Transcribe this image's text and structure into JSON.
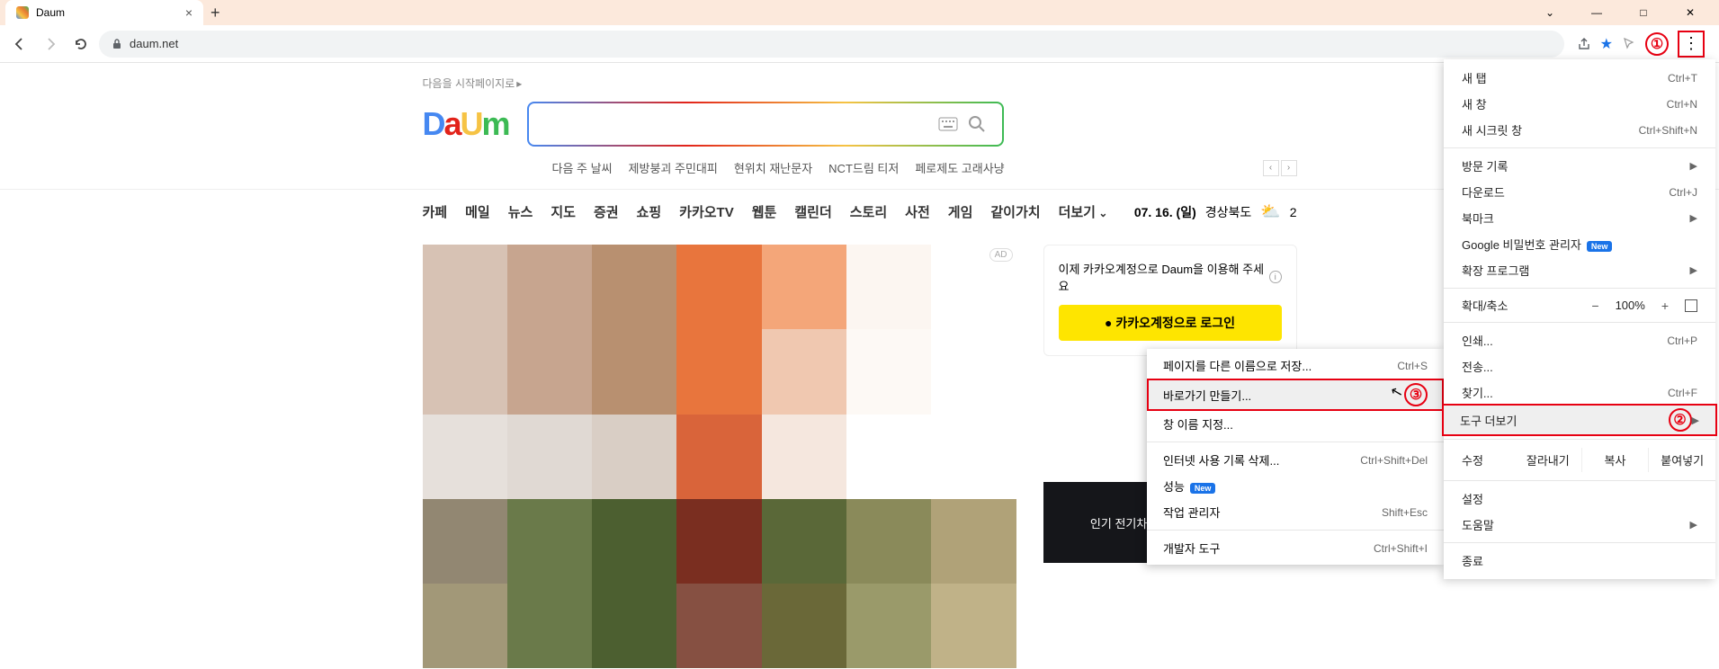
{
  "browser": {
    "tab_title": "Daum",
    "url": "daum.net",
    "window_controls": {
      "min": "—",
      "max": "□",
      "close": "✕",
      "dropdown": "⌄"
    }
  },
  "annotations": {
    "n1": "①",
    "n2": "②",
    "n3": "③"
  },
  "page": {
    "start_link": "다음을 시작페이지로",
    "logo": {
      "d": "D",
      "a": "a",
      "u": "U",
      "m": "m"
    },
    "search": {
      "placeholder": ""
    },
    "trends": [
      "다음 주 날씨",
      "제방붕괴 주민대피",
      "현위치 재난문자",
      "NCT드림 티저",
      "페로제도 고래사냥"
    ],
    "gnb": [
      "카페",
      "메일",
      "뉴스",
      "지도",
      "증권",
      "쇼핑",
      "카카오TV",
      "웹툰",
      "캘린더",
      "스토리",
      "사전",
      "게임",
      "같이가치",
      "더보기"
    ],
    "date": "07. 16. (일)",
    "region": "경상북도",
    "temp": "2",
    "ad_badge": "AD",
    "login_msg": "이제 카카오계정으로 Daum을 이용해 주세요",
    "kakao_login": "카카오계정으로 로그인",
    "side_banner": "인기 전기차, 월 렌탈료 가격 인하"
  },
  "menu": {
    "items": [
      {
        "label": "새 탭",
        "shortcut": "Ctrl+T"
      },
      {
        "label": "새 창",
        "shortcut": "Ctrl+N"
      },
      {
        "label": "새 시크릿 창",
        "shortcut": "Ctrl+Shift+N"
      }
    ],
    "items2": [
      {
        "label": "방문 기록",
        "arrow": true
      },
      {
        "label": "다운로드",
        "shortcut": "Ctrl+J"
      },
      {
        "label": "북마크",
        "arrow": true
      },
      {
        "label": "Google 비밀번호 관리자",
        "badge": "New"
      },
      {
        "label": "확장 프로그램",
        "arrow": true
      }
    ],
    "zoom": {
      "label": "확대/축소",
      "minus": "−",
      "value": "100%",
      "plus": "+"
    },
    "items3": [
      {
        "label": "인쇄...",
        "shortcut": "Ctrl+P"
      },
      {
        "label": "전송..."
      },
      {
        "label": "찾기...",
        "shortcut": "Ctrl+F"
      },
      {
        "label": "도구 더보기",
        "arrow": true,
        "highlight": true
      }
    ],
    "edit": {
      "label": "수정",
      "cut": "잘라내기",
      "copy": "복사",
      "paste": "붙여넣기"
    },
    "items4": [
      {
        "label": "설정"
      },
      {
        "label": "도움말",
        "arrow": true
      }
    ],
    "exit": "종료"
  },
  "submenu": {
    "items": [
      {
        "label": "페이지를 다른 이름으로 저장...",
        "shortcut": "Ctrl+S"
      },
      {
        "label": "바로가기 만들기...",
        "highlight": true
      },
      {
        "label": "창 이름 지정..."
      }
    ],
    "items2": [
      {
        "label": "인터넷 사용 기록 삭제...",
        "shortcut": "Ctrl+Shift+Del"
      },
      {
        "label": "성능",
        "badge": "New"
      },
      {
        "label": "작업 관리자",
        "shortcut": "Shift+Esc"
      }
    ],
    "items3": [
      {
        "label": "개발자 도구",
        "shortcut": "Ctrl+Shift+I"
      }
    ]
  },
  "pixel_colors": [
    "#d7c2b4",
    "#c7a58f",
    "#b89070",
    "#e8753d",
    "#f4a679",
    "#fcf6f1",
    "#fff",
    "#d7c2b4",
    "#c7a58f",
    "#b89070",
    "#e8753d",
    "#f0c8b0",
    "#fdf9f5",
    "#fff",
    "#e6e0db",
    "#e0d9d3",
    "#d9cec5",
    "#d9643a",
    "#f5e7de",
    "#fff",
    "#fff",
    "#928772",
    "#6a7a4a",
    "#4c5f30",
    "#7a2e20",
    "#5a6838",
    "#8a8a5a",
    "#b0a278",
    "#a29878",
    "#6a7a4a",
    "#4c5f30",
    "#865042",
    "#6a6838",
    "#9a9a6a",
    "#c0b288"
  ]
}
